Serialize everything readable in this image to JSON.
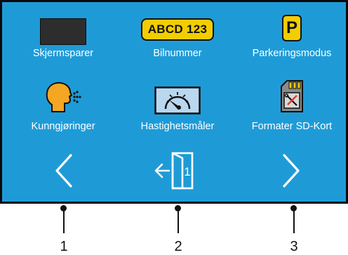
{
  "menu": {
    "items": [
      {
        "label": "Skjermsparer",
        "icon": "screensaver-icon"
      },
      {
        "label": "Bilnummer",
        "icon": "license-plate-icon",
        "plate_text": "ABCD 123"
      },
      {
        "label": "Parkeringsmodus",
        "icon": "parking-icon",
        "icon_text": "P"
      },
      {
        "label": "Kunngjøringer",
        "icon": "announcement-icon"
      },
      {
        "label": "Hastighetsmåler",
        "icon": "speedometer-icon"
      },
      {
        "label": "Formater SD-Kort",
        "icon": "sd-card-icon"
      }
    ]
  },
  "navigation": {
    "back_icon": "chevron-left-icon",
    "exit_icon": "exit-door-icon",
    "exit_badge": "1",
    "next_icon": "chevron-right-icon"
  },
  "callouts": [
    "1",
    "2",
    "3"
  ],
  "colors": {
    "screen_bg": "#1e9bd7",
    "plate_yellow": "#f2cd00",
    "announcement_orange": "#f5a623"
  }
}
